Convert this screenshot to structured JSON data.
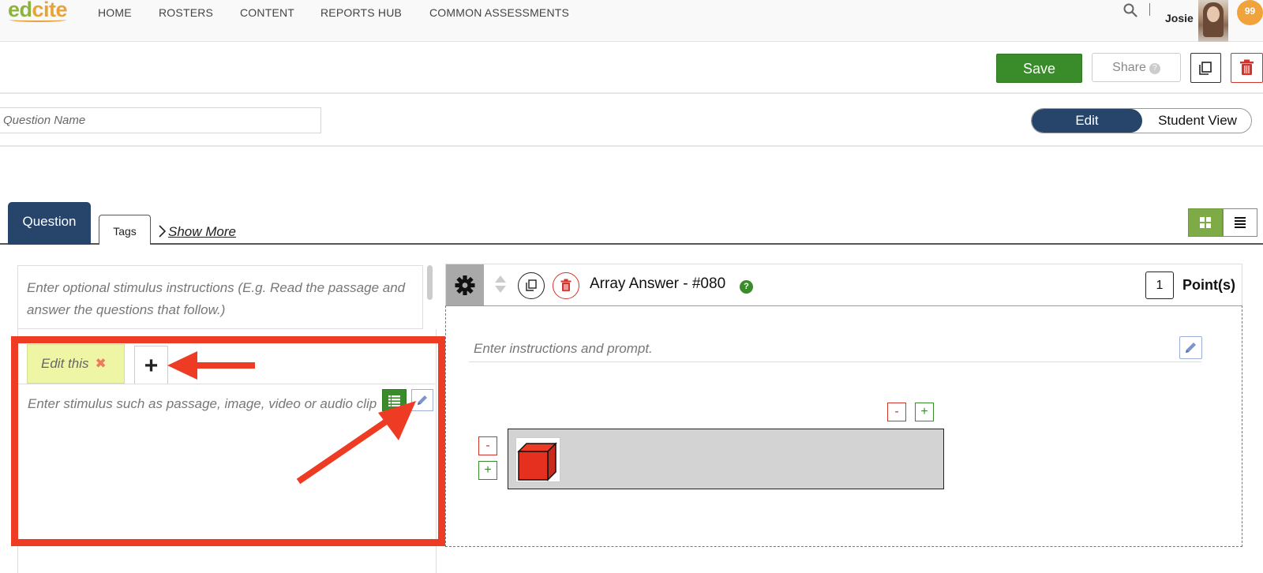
{
  "nav": {
    "logo": {
      "part1": "ed",
      "part2": "cite"
    },
    "links": [
      "HOME",
      "ROSTERS",
      "CONTENT",
      "REPORTS HUB",
      "COMMON ASSESSMENTS"
    ],
    "user_name": "Josie",
    "notification_count": "99"
  },
  "toolbar": {
    "save_label": "Save",
    "share_label": "Share",
    "share_help": "?"
  },
  "question_name": {
    "placeholder": "Question Name",
    "value": ""
  },
  "view_toggle": {
    "edit_label": "Edit",
    "student_label": "Student View",
    "selected": "Edit"
  },
  "tabs": {
    "question_label": "Question",
    "tags_label": "Tags",
    "show_more_label": "Show More"
  },
  "stimulus": {
    "instructions_placeholder": "Enter optional stimulus instructions (E.g. Read the passage and answer the questions that follow.)",
    "tab_label": "Edit this",
    "add_label": "+",
    "body_placeholder": "Enter stimulus such as passage, image, video or audio clip"
  },
  "question": {
    "title": "Array Answer - #080",
    "help": "?",
    "points_value": "1",
    "points_label": "Point(s)",
    "prompt_placeholder": "Enter instructions and prompt.",
    "col_remove": "-",
    "col_add": "+",
    "row_remove": "-",
    "row_add": "+"
  },
  "colors": {
    "accent_navy": "#27446a",
    "save_green": "#3a8c2b",
    "danger_red": "#d0342c",
    "annotation_red": "#ee3b24",
    "grid_view_green": "#7fab47"
  },
  "icons": [
    "search-icon",
    "copy-icon",
    "trash-icon",
    "gear-icon",
    "sort-arrows-icon",
    "grid-icon",
    "list-icon",
    "pencil-icon",
    "plus-icon",
    "close-icon",
    "cube-icon",
    "chevron-right-icon"
  ]
}
